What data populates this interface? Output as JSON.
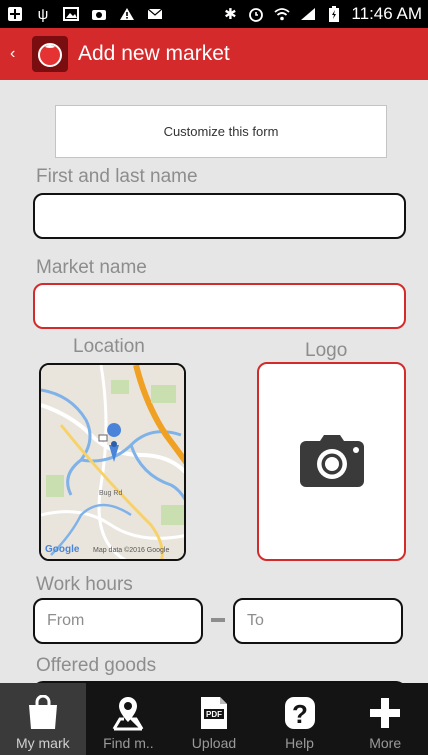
{
  "status_bar": {
    "time": "11:46 AM",
    "left_icons": [
      "add-icon",
      "usb-icon",
      "image-icon",
      "camera-icon",
      "warning-icon",
      "mail-icon"
    ],
    "right_icons": [
      "bluetooth-icon",
      "alarm-icon",
      "wifi-icon",
      "signal-icon",
      "battery-icon"
    ]
  },
  "app_bar": {
    "title": "Add new market"
  },
  "form": {
    "customize_label": "Customize this form",
    "name_label": "First and last name",
    "name_value": "",
    "market_label": "Market name",
    "market_value": "",
    "location_label": "Location",
    "logo_label": "Logo",
    "map_attribution": "Map data ©2016 Google",
    "map_google": "Google",
    "map_road_label": "Bug Rd",
    "work_hours_label": "Work hours",
    "from_placeholder": "From",
    "to_placeholder": "To",
    "offered_goods_label": "Offered goods"
  },
  "bottom_nav": {
    "items": [
      {
        "label": "My mark",
        "icon": "shopping-bag-icon",
        "active": true
      },
      {
        "label": "Find m..",
        "icon": "map-pin-icon",
        "active": false
      },
      {
        "label": "Upload",
        "icon": "pdf-icon",
        "active": false
      },
      {
        "label": "Help",
        "icon": "help-icon",
        "active": false
      },
      {
        "label": "More",
        "icon": "plus-icon",
        "active": false
      }
    ]
  },
  "colors": {
    "accent": "#d42a2b",
    "background": "#e6e6e6",
    "nav_background": "#141414"
  }
}
